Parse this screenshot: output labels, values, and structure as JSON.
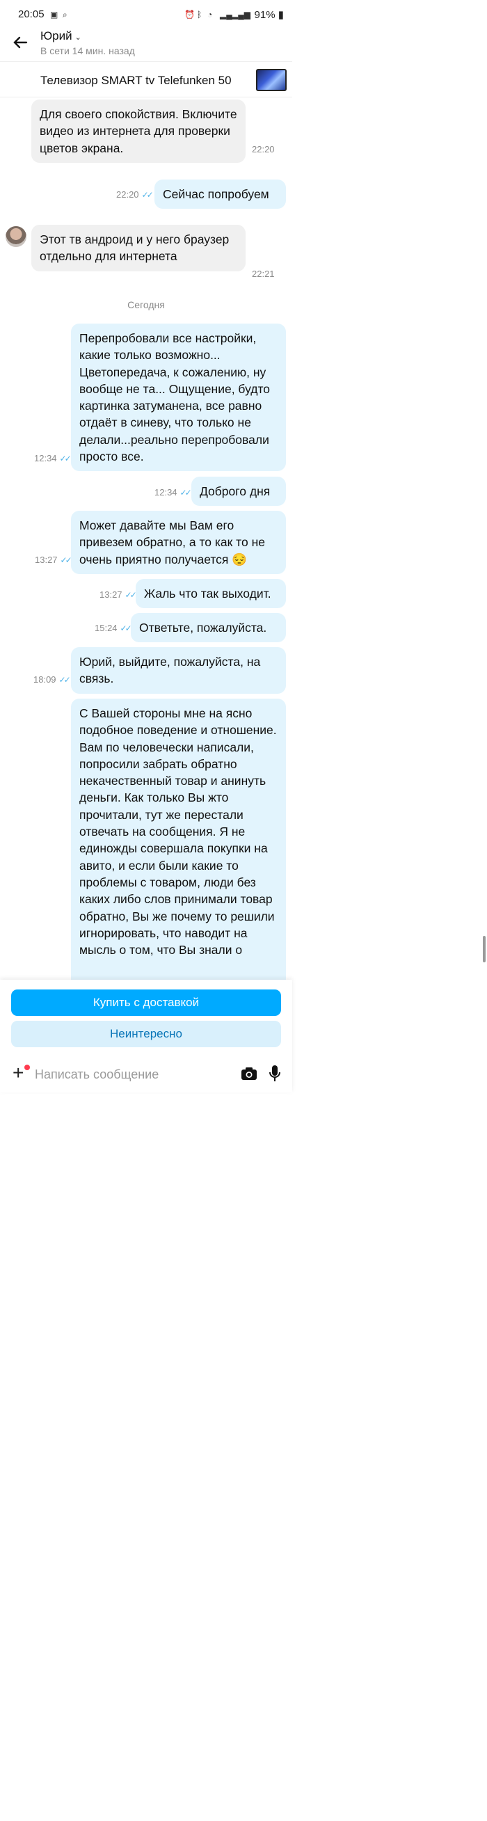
{
  "status_bar": {
    "time": "20:05",
    "battery": "91%"
  },
  "header": {
    "back_icon": "arrow-left-icon",
    "contact_name": "Юрий",
    "last_seen": "В сети 14 мин. назад"
  },
  "product": {
    "title": "Телевизор SMART tv Telefunken 50"
  },
  "messages": [
    {
      "dir": "in",
      "text": "Для своего спокойствия. Включите видео из интернета для проверки цветов экрана.",
      "time": "22:20"
    },
    {
      "dir": "out",
      "text": "Сейчас попробуем",
      "time": "22:20"
    },
    {
      "dir": "in",
      "text": "Этот тв андроид и у него браузер отдельно для интернета",
      "time": "22:21"
    },
    {
      "dir": "out",
      "text": "Перепробовали все настройки, какие только возможно... Цветопередача, к сожалению, ну вообще не та... Ощущение, будто картинка затуманена, все равно отдаёт в синеву, что только не делали...реально перепробовали просто все.",
      "time": "12:34"
    },
    {
      "dir": "out",
      "text": "Доброго дня",
      "time": "12:34"
    },
    {
      "dir": "out",
      "text": "Может давайте мы Вам его привезем обратно, а то как то не очень приятно получается 😔",
      "time": "13:27"
    },
    {
      "dir": "out",
      "text": "Жаль что так выходит.",
      "time": "13:27"
    },
    {
      "dir": "out",
      "text": "Ответьте, пожалуйста.",
      "time": "15:24"
    },
    {
      "dir": "out",
      "text": "Юрий, выйдите, пожалуйста, на связь.",
      "time": "18:09"
    },
    {
      "dir": "out",
      "text": "С Вашей стороны мне на ясно подобное поведение и отношение. Вам по человечески написали, попросили забрать обратно некачественный товар и анинуть деньги. Как только Вы жто прочитали, тут же перестали отвечать на сообщения. Я не единожды совершала покупки на авито, и если были какие то проблемы с товаром, люди без каких либо слов принимали товар обратно, Вы же почему то решили игнорировать, что наводит на мысль о том, что Вы знали о"
    }
  ],
  "date_divider": "Сегодня",
  "actions": {
    "buy_label": "Купить с доставкой",
    "decline_label": "Неинтересно"
  },
  "composer": {
    "placeholder": "Написать сообщение"
  },
  "colors": {
    "accent": "#00aaff",
    "outgoing_bubble": "#e2f4fd",
    "incoming_bubble": "#f0f0f0",
    "read_ticks": "#4fb3e8"
  }
}
